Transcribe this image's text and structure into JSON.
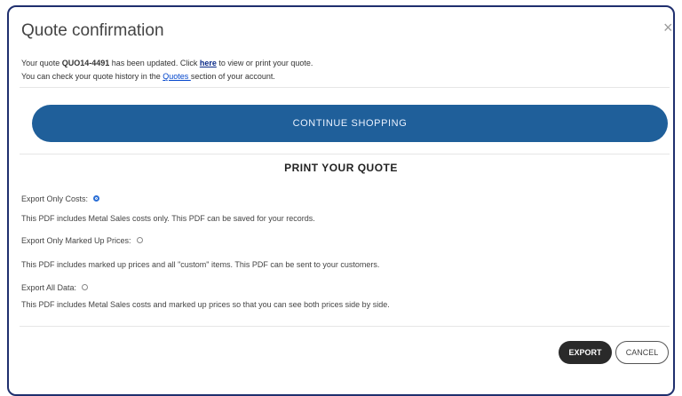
{
  "dialog": {
    "title": "Quote confirmation",
    "close_icon": "×",
    "info": {
      "line1_prefix": "Your quote ",
      "quote_number": "QUO14-4491",
      "line1_mid": " has been updated. Click ",
      "here_link": "here",
      "line1_suffix": " to view or print your quote.",
      "line2_prefix": "You can check your quote history in the ",
      "quotes_link": "Quotes ",
      "line2_suffix": "section of your account."
    },
    "continue_label": "CONTINUE SHOPPING",
    "print_title": "PRINT YOUR QUOTE",
    "options": [
      {
        "label": "Export Only Costs:",
        "checked": true,
        "description": "This PDF includes Metal Sales costs only. This PDF can be saved for your records."
      },
      {
        "label": "Export Only Marked Up Prices:",
        "checked": false,
        "description": "This PDF includes marked up prices and all \"custom\" items. This PDF can be sent to your customers."
      },
      {
        "label": "Export All Data:",
        "checked": false,
        "description": "This PDF includes Metal Sales costs and marked up prices so that you can see both prices side by side."
      }
    ],
    "export_label": "EXPORT",
    "cancel_label": "CANCEL"
  },
  "colors": {
    "frame_border": "#1f2f6e",
    "continue_bg": "#1f5f9a",
    "radio_checked": "#2b6fd6",
    "export_bg": "#2a2a2a"
  }
}
